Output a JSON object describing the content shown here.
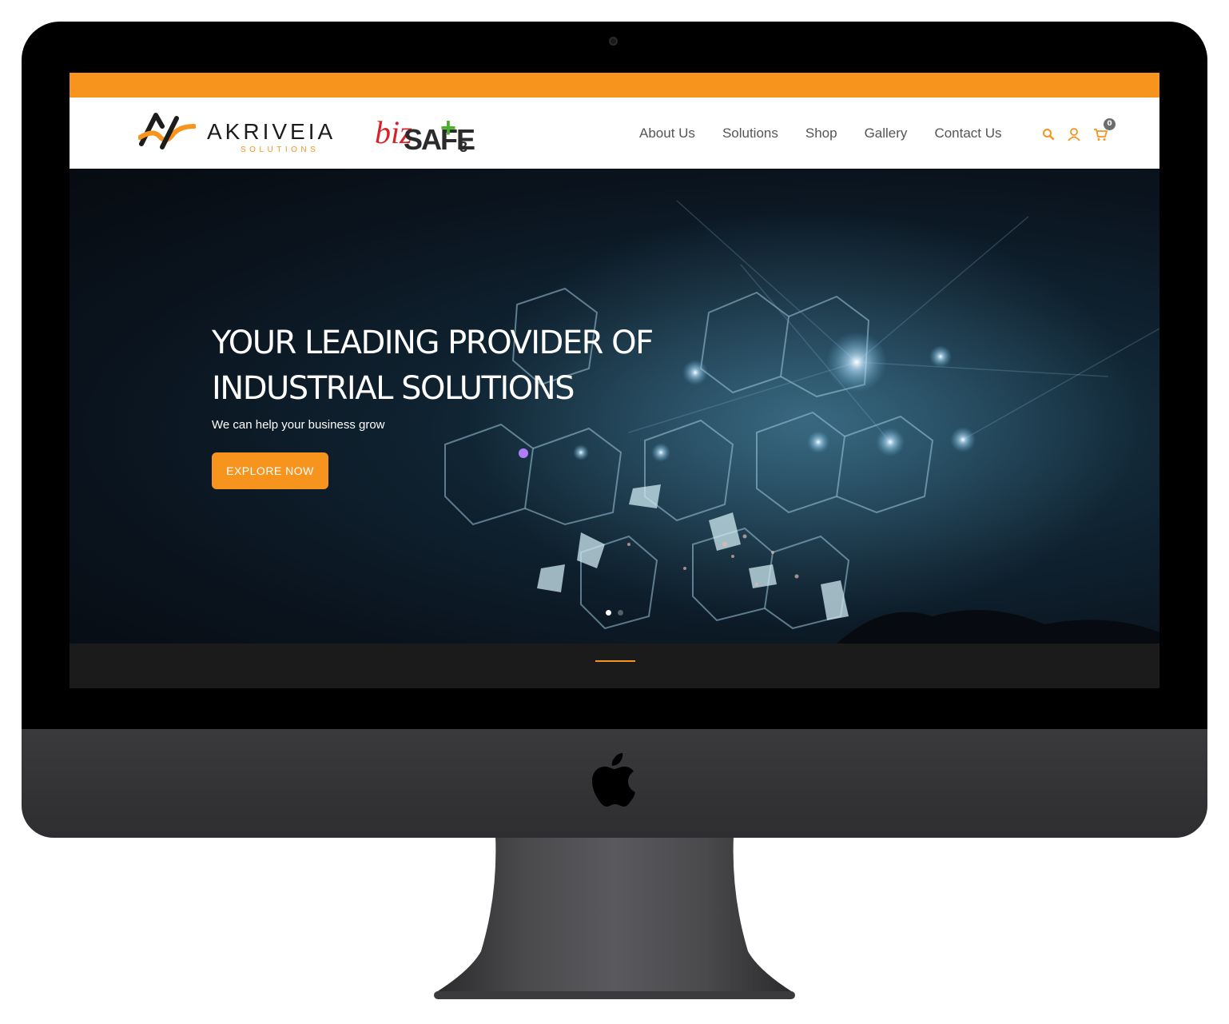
{
  "brand": {
    "accent": "#f7941e",
    "logo_primary": {
      "name": "AKRIVEIA",
      "subtitle": "SOLUTIONS"
    },
    "logo_secondary": {
      "prefix": "biz",
      "main": "SAFE",
      "plus": "+",
      "suffix": "3"
    }
  },
  "nav": {
    "items": [
      {
        "label": "About Us"
      },
      {
        "label": "Solutions"
      },
      {
        "label": "Shop"
      },
      {
        "label": "Gallery"
      },
      {
        "label": "Contact Us"
      }
    ],
    "icons": [
      "search-icon",
      "user-icon",
      "cart-icon"
    ],
    "cart_count": "0"
  },
  "hero": {
    "title_line1": "YOUR LEADING PROVIDER OF",
    "title_line2": "INDUSTRIAL SOLUTIONS",
    "subtitle": "We can help your business grow",
    "cta_label": "EXPLORE NOW",
    "slides": {
      "count": 2,
      "active": 1
    }
  },
  "device": {
    "type": "imac",
    "logo": "apple-logo-icon"
  }
}
